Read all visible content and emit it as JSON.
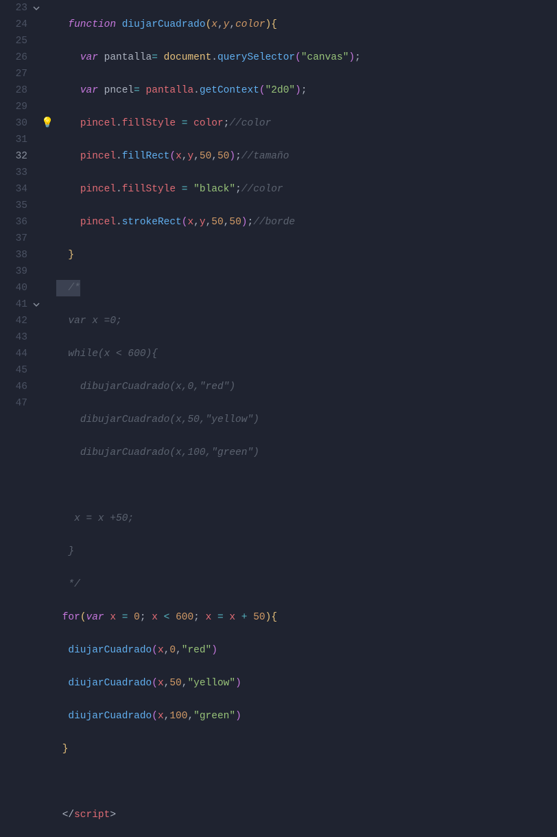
{
  "lineStart": 23,
  "lineNumbers": [
    23,
    24,
    25,
    26,
    27,
    28,
    29,
    30,
    31,
    32,
    33,
    34,
    35,
    36,
    37,
    38,
    39,
    40,
    41,
    42,
    43,
    44,
    45,
    46,
    47
  ],
  "currentLine": 32,
  "foldLines": [
    23,
    41
  ],
  "lightbulbLine": 30,
  "code": {
    "l23": {
      "kw": "function",
      "fn": "diujarCuadrado",
      "params": [
        "x",
        "y",
        "color"
      ]
    },
    "l24": {
      "kw": "var",
      "varname": "pantalla",
      "obj": "document",
      "method": "querySelector",
      "arg": "\"canvas\""
    },
    "l25": {
      "kw": "var",
      "varname": "pncel",
      "obj": "pantalla",
      "method": "getContext",
      "arg": "\"2d0\""
    },
    "l26": {
      "obj": "pincel",
      "prop": "fillStyle",
      "op": "=",
      "val": "color",
      "cmt": "//color"
    },
    "l27": {
      "obj": "pincel",
      "method": "fillRect",
      "args": [
        "x",
        "y",
        "50",
        "50"
      ],
      "cmt": "//tamaño"
    },
    "l28": {
      "obj": "pincel",
      "prop": "fillStyle",
      "op": "=",
      "val": "\"black\"",
      "cmt": "//color"
    },
    "l29": {
      "obj": "pincel",
      "method": "strokeRect",
      "args": [
        "x",
        "y",
        "50",
        "50"
      ],
      "cmt": "//borde"
    },
    "l30": {
      "brace": "}"
    },
    "l31": {
      "cmt": "/*",
      "sel": true
    },
    "l32": {
      "cmt": "var x =0;"
    },
    "l33": {
      "cmt": "while(x < 600){"
    },
    "l34": {
      "cmt": "dibujarCuadrado(x,0,\"red\")"
    },
    "l35": {
      "cmt": "dibujarCuadrado(x,50,\"yellow\")"
    },
    "l36": {
      "cmt": "dibujarCuadrado(x,100,\"green\")"
    },
    "l37": {
      "cmt": ""
    },
    "l38": {
      "cmt": "x = x +50;"
    },
    "l39": {
      "cmt": "}"
    },
    "l40": {
      "cmt": "*/"
    },
    "l41": {
      "kw": "for",
      "kw2": "var",
      "varname": "x",
      "init": "0",
      "cond_lhs": "x",
      "cond_op": "<",
      "cond_rhs": "600",
      "step_lhs": "x",
      "step_op": "=",
      "step_expr": "x + 50"
    },
    "l42": {
      "fn": "diujarCuadrado",
      "args": [
        "x",
        "0",
        "\"red\""
      ]
    },
    "l43": {
      "fn": "diujarCuadrado",
      "args": [
        "x",
        "50",
        "\"yellow\""
      ]
    },
    "l44": {
      "fn": "diujarCuadrado",
      "args": [
        "x",
        "100",
        "\"green\""
      ]
    },
    "l45": {
      "brace": "}"
    },
    "l46": {
      "empty": true
    },
    "l47": {
      "closeTag": "script"
    }
  }
}
